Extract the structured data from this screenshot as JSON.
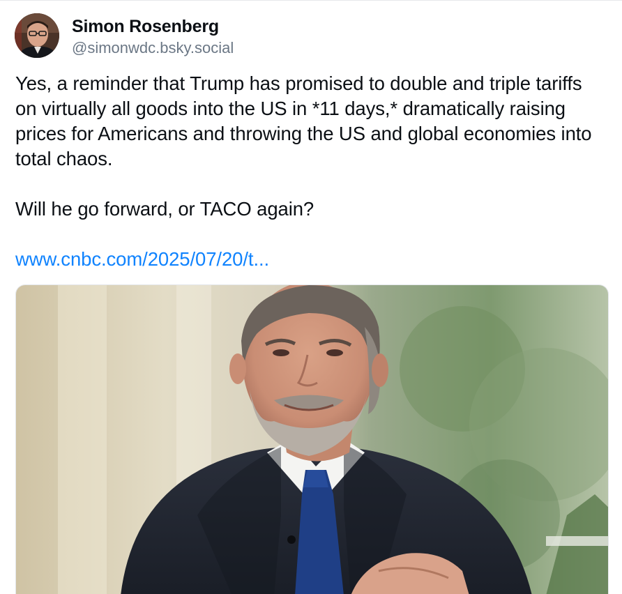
{
  "post": {
    "author": {
      "display_name": "Simon Rosenberg",
      "handle": "@simonwdc.bsky.social",
      "avatar_icon": "avatar-photo"
    },
    "text": {
      "paragraph_1": "Yes, a reminder that Trump has promised to double and triple tariffs on virtually all goods into the US in *11 days,* dramatically raising prices for Americans and throwing the US and global economies into total chaos.",
      "paragraph_2": "Will he go forward, or TACO again?"
    },
    "link": {
      "text": "www.cnbc.com/2025/07/20/t..."
    },
    "media": {
      "kind": "image-photo"
    }
  },
  "colors": {
    "text": "#0b0f14",
    "handle": "#6b7785",
    "link": "#1083fe",
    "border": "#e6e8eb"
  }
}
